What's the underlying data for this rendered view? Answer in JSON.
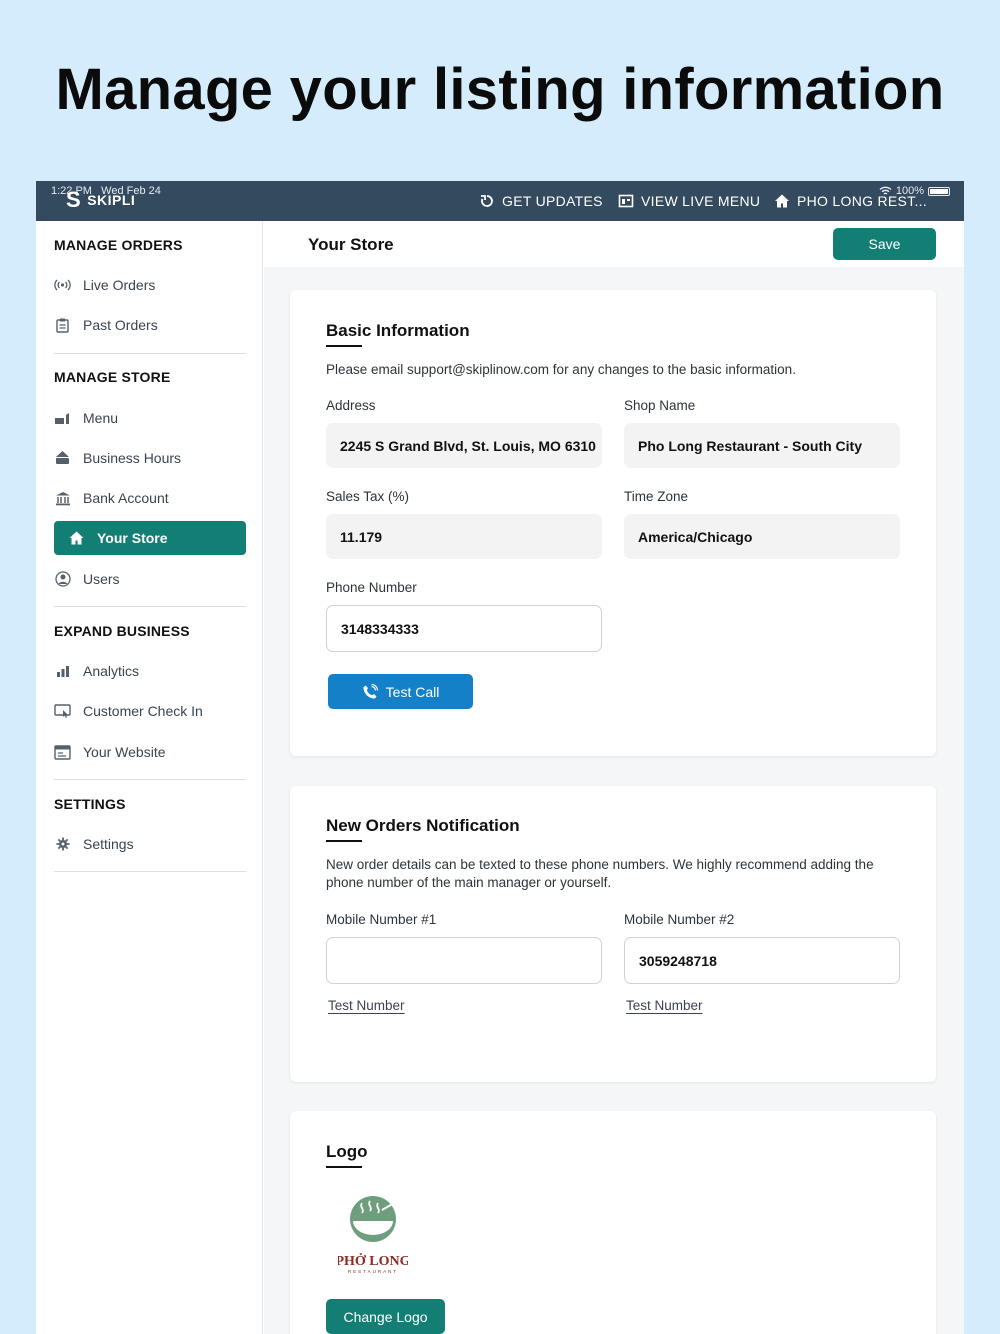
{
  "headline": "Manage your listing information",
  "status": {
    "time": "1:22 PM",
    "date": "Wed Feb 24",
    "battery": "100%"
  },
  "topbar": {
    "brand": "SKIPLI",
    "get_updates": "GET UPDATES",
    "view_live_menu": "VIEW LIVE MENU",
    "shop": "PHO LONG REST..."
  },
  "sidebar": {
    "manage_orders": "MANAGE ORDERS",
    "live_orders": "Live Orders",
    "past_orders": "Past Orders",
    "manage_store": "MANAGE STORE",
    "menu": "Menu",
    "business_hours": "Business Hours",
    "bank_account": "Bank Account",
    "your_store": "Your Store",
    "users": "Users",
    "expand_business": "EXPAND BUSINESS",
    "analytics": "Analytics",
    "customer_check_in": "Customer Check In",
    "your_website": "Your Website",
    "settings_title": "SETTINGS",
    "settings": "Settings"
  },
  "header": {
    "title": "Your Store",
    "save": "Save"
  },
  "basic": {
    "title": "Basic Information",
    "note": "Please email support@skiplinow.com for any changes to the basic information.",
    "address_label": "Address",
    "address_value": "2245 S Grand Blvd, St. Louis, MO 6310",
    "shop_name_label": "Shop Name",
    "shop_name_value": "Pho Long Restaurant - South City",
    "sales_tax_label": "Sales Tax (%)",
    "sales_tax_value": "11.179",
    "time_zone_label": "Time Zone",
    "time_zone_value": "America/Chicago",
    "phone_label": "Phone Number",
    "phone_value": "3148334333",
    "test_call": "Test Call"
  },
  "notify": {
    "title": "New Orders Notification",
    "note": "New order details can be texted to these phone numbers. We highly recommend adding the phone number of the main manager or yourself.",
    "mobile1_label": "Mobile Number #1",
    "mobile1_value": "",
    "mobile2_label": "Mobile Number #2",
    "mobile2_value": "3059248718",
    "test_number_1": "Test Number",
    "test_number_2": "Test Number"
  },
  "logo": {
    "title": "Logo",
    "brand_name": "PHỞ LONG",
    "brand_sub": "RESTAURANT",
    "change": "Change Logo"
  },
  "colors": {
    "teal": "#137f74",
    "blue": "#1480c8",
    "topbar": "#344a5e",
    "background": "#d4ecfb"
  }
}
